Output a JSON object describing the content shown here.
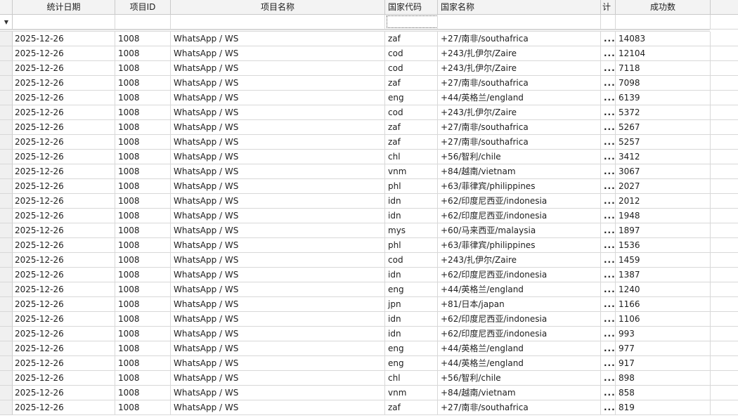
{
  "columns": {
    "date": "统计日期",
    "project_id": "项目ID",
    "project_name": "项目名称",
    "country_code": "国家代码",
    "country_name": "国家名称",
    "truncated": "计",
    "success": "成功数"
  },
  "filter_icon": "filter-icon",
  "rows": [
    [
      "2025-12-26",
      "1008",
      "WhatsApp / WS",
      "zaf",
      "+27/南非/southafrica",
      "...",
      "14083"
    ],
    [
      "2025-12-26",
      "1008",
      "WhatsApp / WS",
      "cod",
      "+243/扎伊尔/Zaire",
      "...",
      "12104"
    ],
    [
      "2025-12-26",
      "1008",
      "WhatsApp / WS",
      "cod",
      "+243/扎伊尔/Zaire",
      "...",
      "7118"
    ],
    [
      "2025-12-26",
      "1008",
      "WhatsApp / WS",
      "zaf",
      "+27/南非/southafrica",
      "...",
      "7098"
    ],
    [
      "2025-12-26",
      "1008",
      "WhatsApp / WS",
      "eng",
      "+44/英格兰/england",
      "...",
      "6139"
    ],
    [
      "2025-12-26",
      "1008",
      "WhatsApp / WS",
      "cod",
      "+243/扎伊尔/Zaire",
      "...",
      "5372"
    ],
    [
      "2025-12-26",
      "1008",
      "WhatsApp / WS",
      "zaf",
      "+27/南非/southafrica",
      "...",
      "5267"
    ],
    [
      "2025-12-26",
      "1008",
      "WhatsApp / WS",
      "zaf",
      "+27/南非/southafrica",
      "...",
      "5257"
    ],
    [
      "2025-12-26",
      "1008",
      "WhatsApp / WS",
      "chl",
      "+56/智利/chile",
      "...",
      "3412"
    ],
    [
      "2025-12-26",
      "1008",
      "WhatsApp / WS",
      "vnm",
      "+84/越南/vietnam",
      "...",
      "3067"
    ],
    [
      "2025-12-26",
      "1008",
      "WhatsApp / WS",
      "phl",
      "+63/菲律宾/philippines",
      "...",
      "2027"
    ],
    [
      "2025-12-26",
      "1008",
      "WhatsApp / WS",
      "idn",
      "+62/印度尼西亚/indonesia",
      "...",
      "2012"
    ],
    [
      "2025-12-26",
      "1008",
      "WhatsApp / WS",
      "idn",
      "+62/印度尼西亚/indonesia",
      "...",
      "1948"
    ],
    [
      "2025-12-26",
      "1008",
      "WhatsApp / WS",
      "mys",
      "+60/马来西亚/malaysia",
      "...",
      "1897"
    ],
    [
      "2025-12-26",
      "1008",
      "WhatsApp / WS",
      "phl",
      "+63/菲律宾/philippines",
      "...",
      "1536"
    ],
    [
      "2025-12-26",
      "1008",
      "WhatsApp / WS",
      "cod",
      "+243/扎伊尔/Zaire",
      "...",
      "1459"
    ],
    [
      "2025-12-26",
      "1008",
      "WhatsApp / WS",
      "idn",
      "+62/印度尼西亚/indonesia",
      "...",
      "1387"
    ],
    [
      "2025-12-26",
      "1008",
      "WhatsApp / WS",
      "eng",
      "+44/英格兰/england",
      "...",
      "1240"
    ],
    [
      "2025-12-26",
      "1008",
      "WhatsApp / WS",
      "jpn",
      "+81/日本/japan",
      "...",
      "1166"
    ],
    [
      "2025-12-26",
      "1008",
      "WhatsApp / WS",
      "idn",
      "+62/印度尼西亚/indonesia",
      "...",
      "1106"
    ],
    [
      "2025-12-26",
      "1008",
      "WhatsApp / WS",
      "idn",
      "+62/印度尼西亚/indonesia",
      "...",
      "993"
    ],
    [
      "2025-12-26",
      "1008",
      "WhatsApp / WS",
      "eng",
      "+44/英格兰/england",
      "...",
      "977"
    ],
    [
      "2025-12-26",
      "1008",
      "WhatsApp / WS",
      "eng",
      "+44/英格兰/england",
      "...",
      "917"
    ],
    [
      "2025-12-26",
      "1008",
      "WhatsApp / WS",
      "chl",
      "+56/智利/chile",
      "...",
      "898"
    ],
    [
      "2025-12-26",
      "1008",
      "WhatsApp / WS",
      "vnm",
      "+84/越南/vietnam",
      "...",
      "858"
    ],
    [
      "2025-12-26",
      "1008",
      "WhatsApp / WS",
      "zaf",
      "+27/南非/southafrica",
      "...",
      "819"
    ]
  ]
}
